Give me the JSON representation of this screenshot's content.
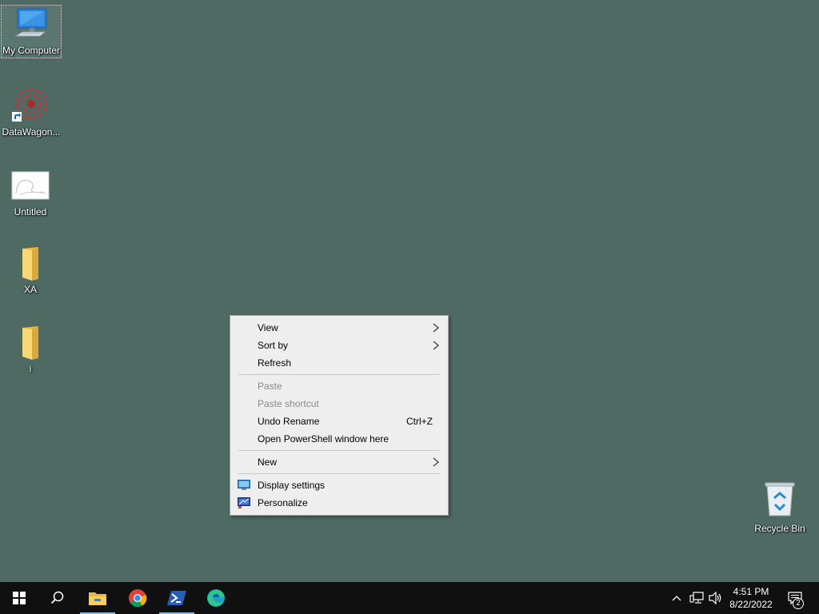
{
  "desktop": {
    "background_color": "#4e6a63",
    "icons": [
      {
        "label": "My Computer",
        "icon": "computer-icon"
      },
      {
        "label": "DataWagon...",
        "icon": "datawagon-shortcut-icon"
      },
      {
        "label": "Untitled",
        "icon": "image-file-icon"
      },
      {
        "label": "XA",
        "icon": "folder-icon"
      },
      {
        "label": "i",
        "icon": "folder-icon"
      },
      {
        "label": "Recycle Bin",
        "icon": "recycle-bin-icon"
      }
    ]
  },
  "context_menu": {
    "items": {
      "view": {
        "label": "View",
        "submenu": true
      },
      "sort_by": {
        "label": "Sort by",
        "submenu": true
      },
      "refresh": {
        "label": "Refresh"
      },
      "paste": {
        "label": "Paste",
        "enabled": false
      },
      "paste_shortcut": {
        "label": "Paste shortcut",
        "enabled": false
      },
      "undo_rename": {
        "label": "Undo Rename",
        "shortcut": "Ctrl+Z"
      },
      "open_powershell": {
        "label": "Open PowerShell window here"
      },
      "new": {
        "label": "New",
        "submenu": true
      },
      "display_settings": {
        "label": "Display settings",
        "icon": "display-settings-icon"
      },
      "personalize": {
        "label": "Personalize",
        "icon": "personalize-icon"
      }
    }
  },
  "taskbar": {
    "pinned": [
      "start-icon",
      "search-icon",
      "file-explorer-icon",
      "chrome-icon",
      "powershell-icon",
      "edge-icon"
    ],
    "tray": {
      "time": "4:51 PM",
      "date": "8/22/2022",
      "notification_count": "2",
      "icons": [
        "chevron-up-icon",
        "network-icon",
        "volume-icon",
        "action-center-icon"
      ]
    }
  }
}
